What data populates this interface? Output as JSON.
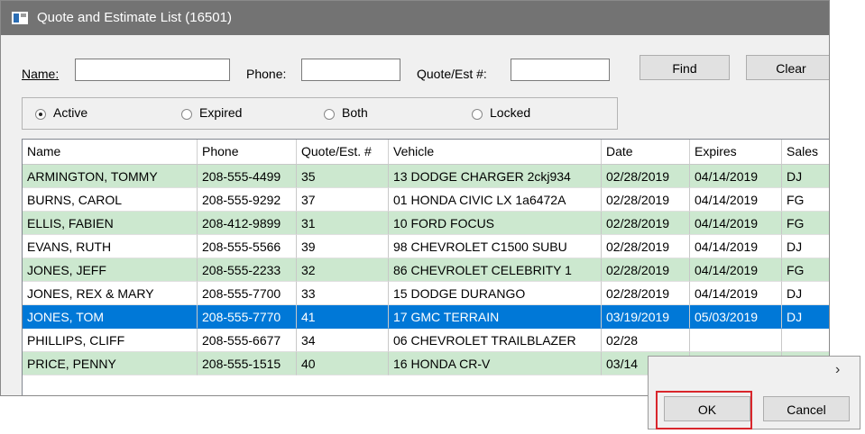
{
  "window": {
    "title": "Quote and Estimate List (16501)"
  },
  "search": {
    "name_label": "Name:",
    "name_value": "",
    "phone_label": "Phone:",
    "phone_value": "",
    "quote_label": "Quote/Est #:",
    "quote_value": "",
    "find_label": "Find",
    "clear_label": "Clear"
  },
  "filters": [
    {
      "label": "Active",
      "selected": true
    },
    {
      "label": "Expired",
      "selected": false
    },
    {
      "label": "Both",
      "selected": false
    },
    {
      "label": "Locked",
      "selected": false
    }
  ],
  "table": {
    "columns": [
      "Name",
      "Phone",
      "Quote/Est. #",
      "Vehicle",
      "Date",
      "Expires",
      "Sales"
    ],
    "rows": [
      {
        "cells": [
          "ARMINGTON, TOMMY",
          "208-555-4499",
          "35",
          "13 DODGE CHARGER 2ckj934",
          "02/28/2019",
          "04/14/2019",
          "DJ"
        ]
      },
      {
        "cells": [
          "BURNS, CAROL",
          "208-555-9292",
          "37",
          "01 HONDA CIVIC LX 1a6472A",
          "02/28/2019",
          "04/14/2019",
          "FG"
        ]
      },
      {
        "cells": [
          "ELLIS, FABIEN",
          "208-412-9899",
          "31",
          "10 FORD FOCUS",
          "02/28/2019",
          "04/14/2019",
          "FG"
        ]
      },
      {
        "cells": [
          "EVANS, RUTH",
          "208-555-5566",
          "39",
          "98 CHEVROLET C1500 SUBU",
          "02/28/2019",
          "04/14/2019",
          "DJ"
        ]
      },
      {
        "cells": [
          "JONES, JEFF",
          "208-555-2233",
          "32",
          "86 CHEVROLET CELEBRITY 1",
          "02/28/2019",
          "04/14/2019",
          "FG"
        ]
      },
      {
        "cells": [
          "JONES, REX & MARY",
          "208-555-7700",
          "33",
          "15 DODGE DURANGO",
          "02/28/2019",
          "04/14/2019",
          "DJ"
        ]
      },
      {
        "cells": [
          "JONES, TOM",
          "208-555-7770",
          "41",
          "17 GMC TERRAIN",
          "03/19/2019",
          "05/03/2019",
          "DJ"
        ]
      },
      {
        "cells": [
          "PHILLIPS, CLIFF",
          "208-555-6677",
          "34",
          "06 CHEVROLET TRAILBLAZER",
          "02/28",
          "",
          ""
        ]
      },
      {
        "cells": [
          "PRICE, PENNY",
          "208-555-1515",
          "40",
          "16 HONDA CR-V",
          "03/14",
          "",
          ""
        ]
      }
    ]
  },
  "buttons": {
    "ok_label": "OK",
    "cancel_label": "Cancel",
    "scroll_glyph": "›"
  },
  "colors": {
    "title_bar": "#737373",
    "alt_row": "#cce8cf",
    "selection": "#0078d7",
    "highlight": "#d9262c"
  }
}
